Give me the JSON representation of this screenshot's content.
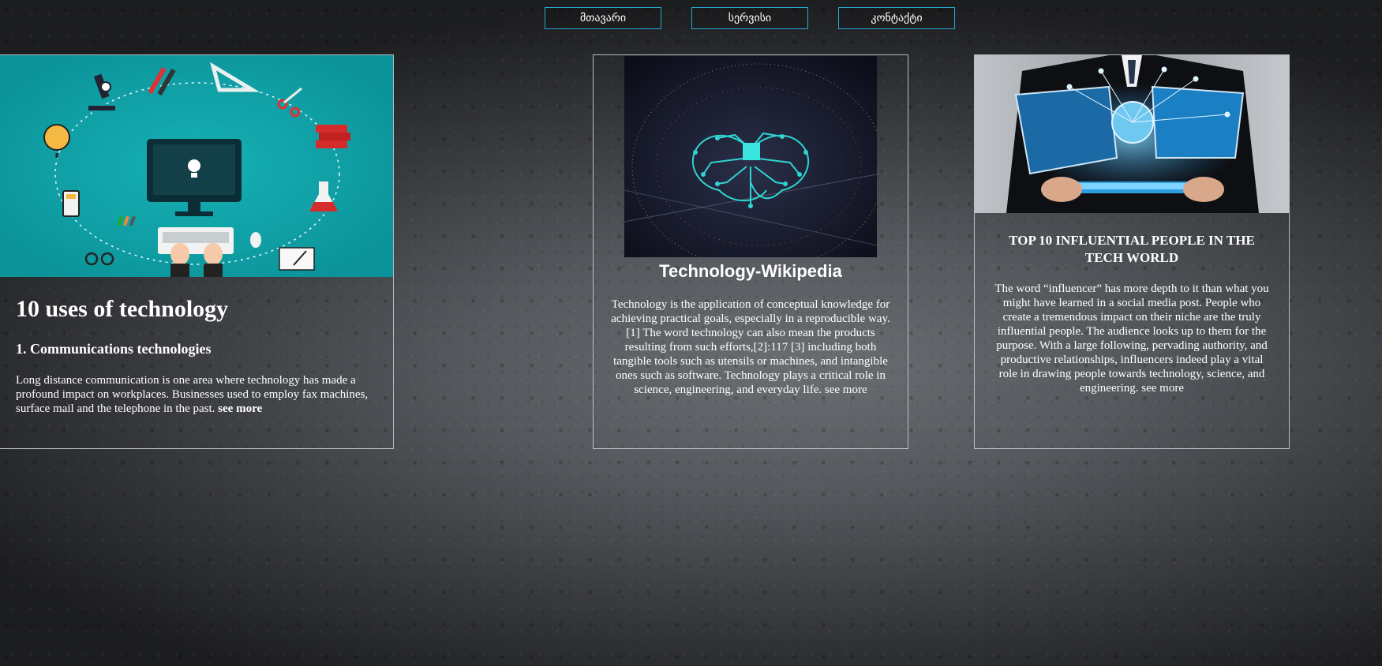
{
  "nav": {
    "items": [
      {
        "label": "მთავარი"
      },
      {
        "label": "სერვისი"
      },
      {
        "label": "კონტაქტი"
      }
    ]
  },
  "cards": [
    {
      "image_icon": "education-technology-illustration",
      "title": "10 uses of technology",
      "subtitle": "1. Communications technologies",
      "text": "Long distance communication is one area where technology has made a profound impact on workplaces. Businesses used to employ fax machines, surface mail and the telephone in the past.",
      "link": "see more"
    },
    {
      "image_icon": "circuit-brain-globe-image",
      "title": "Technology-Wikipedia",
      "text": "Technology is the application of conceptual knowledge for achieving practical goals, especially in a reproducible way.[1] The word technology can also mean the products resulting from such efforts,[2]:117 [3] including both tangible tools such as utensils or machines, and intangible ones such as software. Technology plays a critical role in science, engineering, and everyday life.",
      "link": "see more"
    },
    {
      "image_icon": "hands-holding-tablet-network-image",
      "title": "TOP 10 INFLUENTIAL PEOPLE IN THE TECH WORLD",
      "text": "The word “influencer” has more depth to it than what you might have learned in a social media post. People who create a tremendous impact on their niche are the truly influential people. The audience looks up to them for the purpose. With a large following, pervading authority, and productive relationships, influencers indeed play a vital role in drawing people towards technology, science, and engineering.",
      "link": "see more"
    }
  ],
  "colors": {
    "nav_border": "#2aa7cf",
    "card_border": "#b9bcc0",
    "teal": "#0fa3a8"
  }
}
